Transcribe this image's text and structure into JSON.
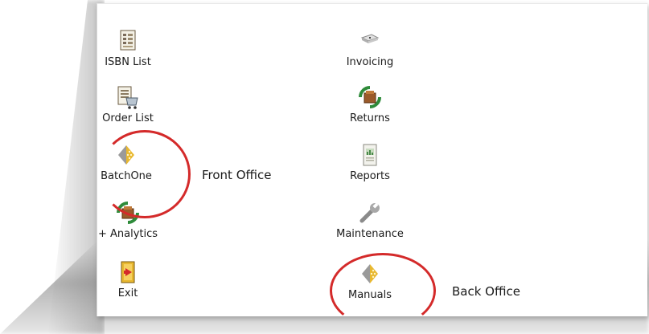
{
  "front_office": {
    "items": [
      {
        "label": "ISBN List",
        "icon": "isbn-list-icon"
      },
      {
        "label": "Order List",
        "icon": "order-list-icon"
      },
      {
        "label": "BatchOne",
        "icon": "batchone-icon"
      },
      {
        "label": "+ Analytics",
        "icon": "analytics-icon"
      },
      {
        "label": "Exit",
        "icon": "exit-icon"
      }
    ],
    "annotation": "Front Office"
  },
  "back_office": {
    "items": [
      {
        "label": "Invoicing",
        "icon": "invoicing-icon"
      },
      {
        "label": "Returns",
        "icon": "returns-icon"
      },
      {
        "label": "Reports",
        "icon": "reports-icon"
      },
      {
        "label": "Maintenance",
        "icon": "wrench-icon"
      },
      {
        "label": "Manuals",
        "icon": "manuals-icon"
      }
    ],
    "annotation": "Back Office"
  },
  "colors": {
    "highlight_ring": "#d42a2a",
    "batchone_gold": "#e8b830",
    "recycle_green": "#2e8b3a"
  }
}
